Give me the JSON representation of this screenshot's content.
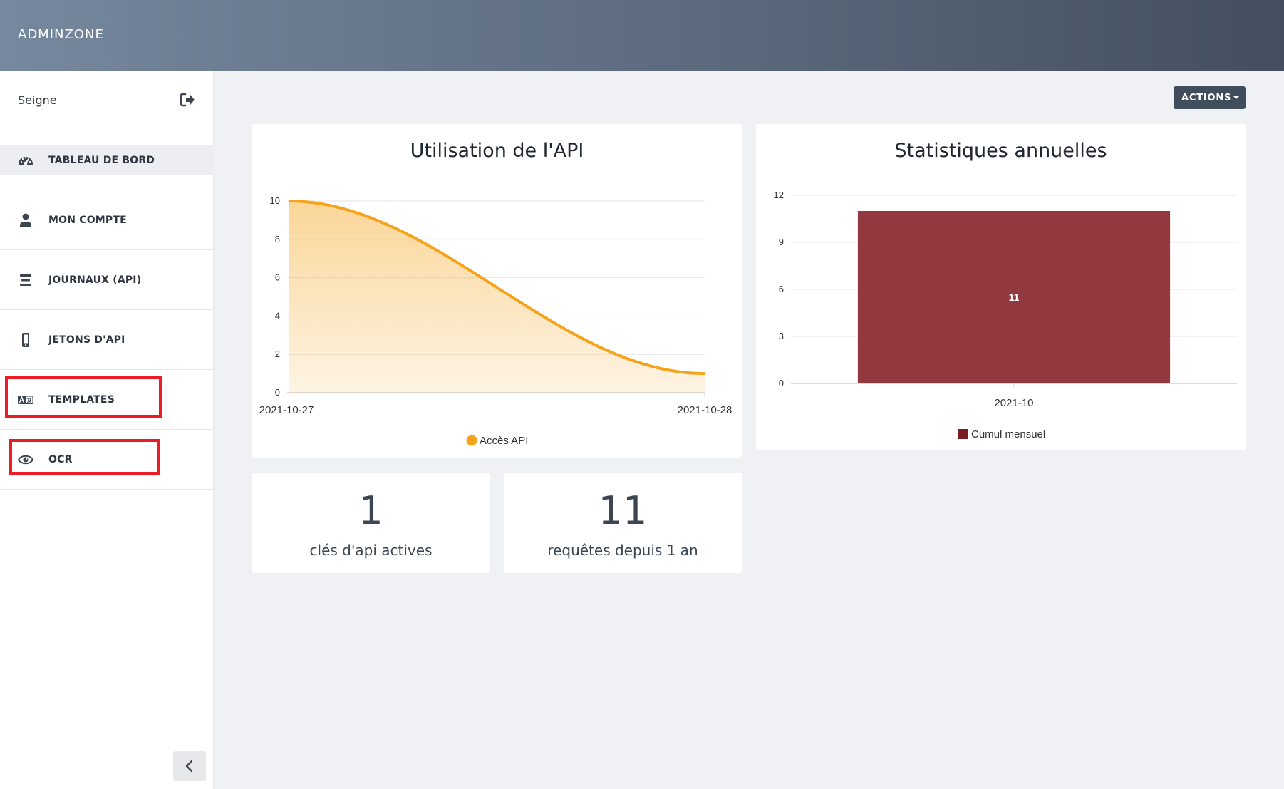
{
  "header": {
    "brand": "ADMINZONE"
  },
  "sidebar": {
    "user_name": "Seigne",
    "logout_icon": "sign-out-icon",
    "items": [
      {
        "label": "TABLEAU DE BORD",
        "icon": "dashboard-icon",
        "active": true
      },
      {
        "label": "MON COMPTE",
        "icon": "user-icon",
        "active": false
      },
      {
        "label": "JOURNAUX (API)",
        "icon": "list-icon",
        "active": false
      },
      {
        "label": "JETONS D'API",
        "icon": "mobile-icon",
        "active": false
      },
      {
        "label": "TEMPLATES",
        "icon": "translate-icon",
        "active": false
      },
      {
        "label": "OCR",
        "icon": "eye-icon",
        "active": false
      }
    ],
    "collapse_icon": "chevron-left-icon"
  },
  "toolbar": {
    "actions_label": "ACTIONS"
  },
  "stats": [
    {
      "value": "1",
      "label": "clés d'api actives"
    },
    {
      "value": "11",
      "label": "requêtes depuis 1 an"
    }
  ],
  "colors": {
    "line": "#f5a31a",
    "bar": "#8b2e34",
    "accent_highlight": "#ec1c24"
  },
  "chart_data": [
    {
      "type": "area",
      "title": "Utilisation de l'API",
      "x": [
        "2021-10-27",
        "2021-10-28"
      ],
      "series": [
        {
          "name": "Accès API",
          "values": [
            10,
            1
          ]
        }
      ],
      "ylim": [
        0,
        10
      ],
      "yticks": [
        0,
        2,
        4,
        6,
        8,
        10
      ],
      "grid": true,
      "legend": "bottom"
    },
    {
      "type": "bar",
      "title": "Statistiques annuelles",
      "categories": [
        "2021-10"
      ],
      "series": [
        {
          "name": "Cumul mensuel",
          "values": [
            11
          ]
        }
      ],
      "data_labels": [
        "11"
      ],
      "ylim": [
        0,
        12
      ],
      "yticks": [
        0,
        3,
        6,
        9,
        12
      ],
      "grid": true,
      "legend": "bottom"
    }
  ]
}
